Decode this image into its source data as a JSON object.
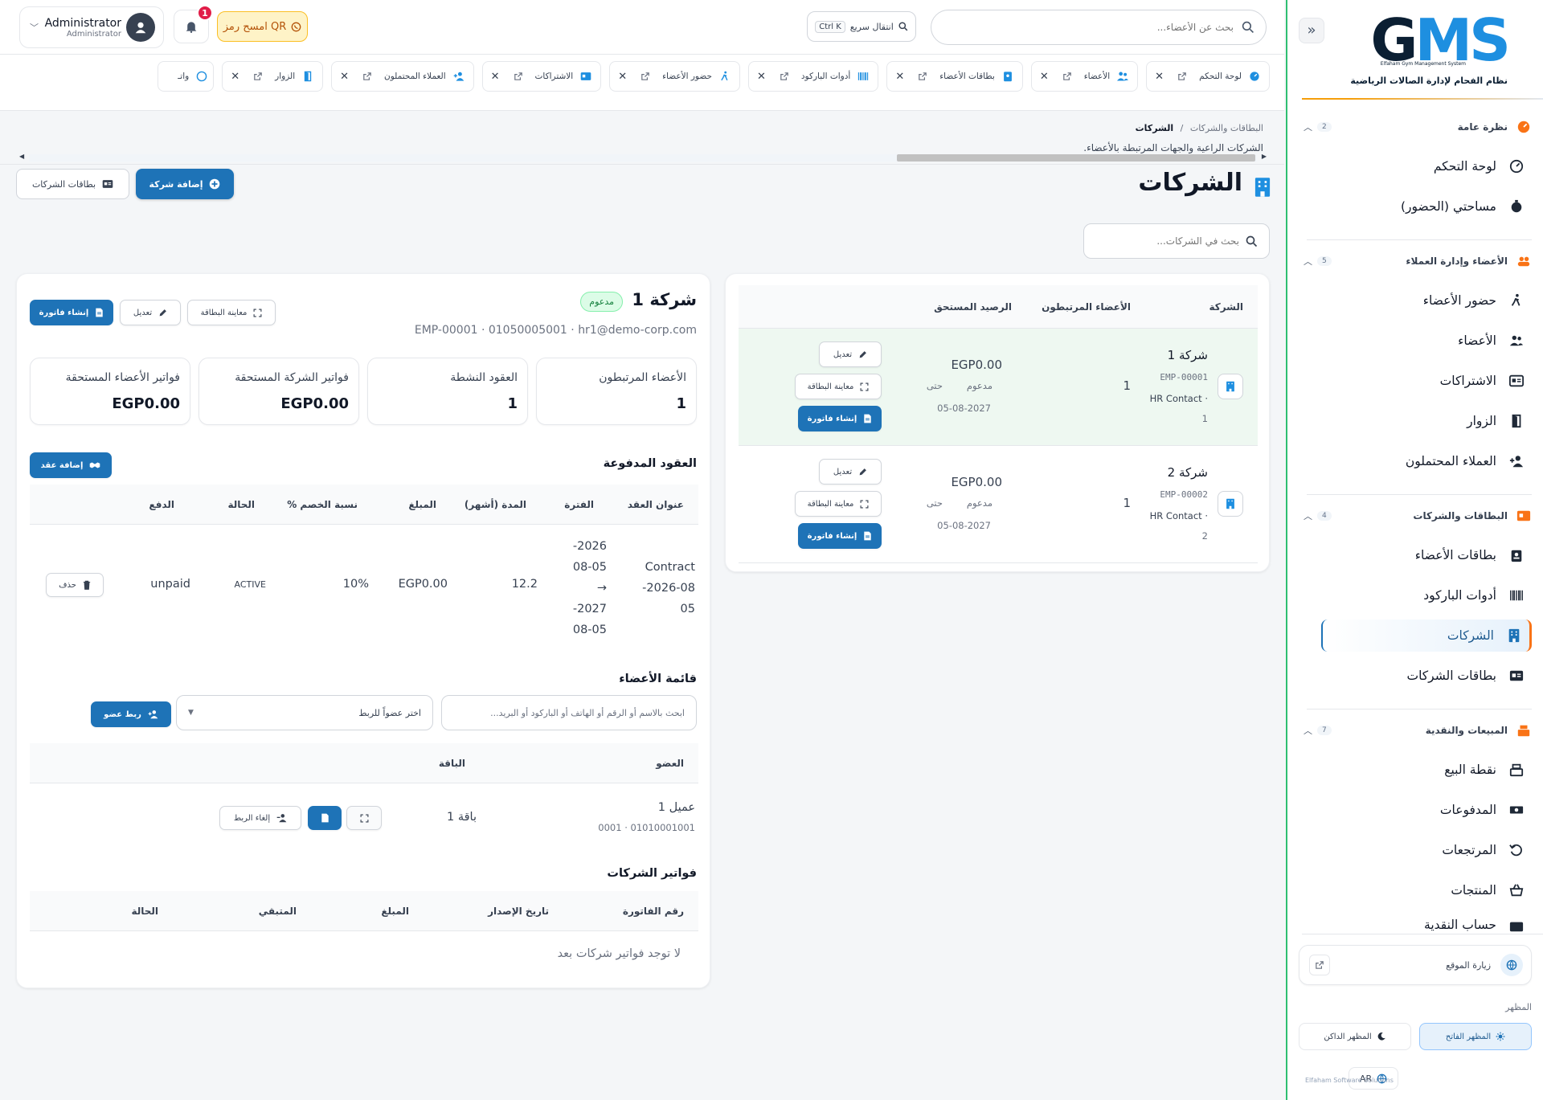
{
  "sidebar": {
    "logo_en": "Elfaham Gym Management System",
    "logo_ar": "نظام الفحام لإدارة الصالات الرياضية",
    "sections": [
      {
        "title": "نظرة عامة",
        "count": "2",
        "items": [
          "لوحة التحكم",
          "مساحتي (الحضور)"
        ]
      },
      {
        "title": "الأعضاء وإدارة العملاء",
        "count": "5",
        "items": [
          "حضور الأعضاء",
          "الأعضاء",
          "الاشتراكات",
          "الزوار",
          "العملاء المحتملون"
        ]
      },
      {
        "title": "البطاقات والشركات",
        "count": "4",
        "items": [
          "بطاقات الأعضاء",
          "أدوات الباركود",
          "الشركات",
          "بطاقات الشركات"
        ]
      },
      {
        "title": "المبيعات والنقدية",
        "count": "7",
        "items": [
          "نقطة البيع",
          "المدفوعات",
          "المرتجعات",
          "المنتجات",
          "حساب النقدية"
        ]
      }
    ],
    "visit_site": "زيارة الموقع",
    "appearance_label": "المظهر",
    "theme_light": "المظهر الفاتح",
    "theme_dark": "المظهر الداكن",
    "lang": "AR",
    "footer": "Elfaham Software Solutions"
  },
  "header": {
    "user_name": "Administrator",
    "user_role": "Administrator",
    "notif_count": "1",
    "qr_label": "امسح رمز QR",
    "quick_jump": "انتقال سريع",
    "quick_jump_kbd": "Ctrl K",
    "member_search_placeholder": "بحث عن الأعضاء..."
  },
  "tabs": [
    "لوحة التحكم",
    "الأعضاء",
    "بطاقات الأعضاء",
    "أدوات الباركود",
    "حضور الأعضاء",
    "الاشتراكات",
    "العملاء المحتملون",
    "الزوار",
    "واتـ"
  ],
  "page": {
    "breadcrumb_parent": "البطاقات والشركات",
    "breadcrumb_sep": "/",
    "breadcrumb_current": "الشركات",
    "subtitle": "الشركات الراعية والجهات المرتبطة بالأعضاء.",
    "title": "الشركات",
    "add_company": "إضافة شركة",
    "company_cards": "بطاقات الشركات",
    "search_placeholder": "بحث في الشركات..."
  },
  "company_list": {
    "columns": [
      "الشركة",
      "الأعضاء المرتبطون",
      "الرصيد المستحق"
    ],
    "rows": [
      {
        "name": "شركة 1",
        "code": "EMP-00001",
        "contact": "· HR Contact",
        "num": "1",
        "members": "1",
        "balance": "EGP0.00",
        "status": "مدعوم",
        "until": "حتى",
        "date": "05-08-2027"
      },
      {
        "name": "شركة 2",
        "code": "EMP-00002",
        "contact": "· HR Contact",
        "num": "2",
        "members": "1",
        "balance": "EGP0.00",
        "status": "مدعوم",
        "until": "حتى",
        "date": "05-08-2027"
      }
    ],
    "edit": "تعديل",
    "preview_card": "معاينة البطاقة",
    "create_invoice": "إنشاء فاتورة"
  },
  "detail": {
    "name": "شركة 1",
    "badge": "مدعوم",
    "info": "EMP-00001 · 01050005001 · hr1@demo-corp.com",
    "buttons": {
      "preview_card": "معاينة البطاقة",
      "edit": "تعديل",
      "create_invoice": "إنشاء فاتورة"
    },
    "stats": [
      {
        "label": "الأعضاء المرتبطون",
        "value": "1"
      },
      {
        "label": "العقود النشطة",
        "value": "1"
      },
      {
        "label": "فواتير الشركة المستحقة",
        "value": "EGP0.00"
      },
      {
        "label": "فواتير الأعضاء المستحقة",
        "value": "EGP0.00"
      }
    ],
    "contracts": {
      "title": "العقود المدفوعة",
      "add": "إضافة عقد",
      "columns": [
        "عنوان العقد",
        "الفترة",
        "المدة (أشهر)",
        "المبلغ",
        "نسبة الخصم %",
        "الحالة",
        "الدفع"
      ],
      "row": {
        "title_lines": [
          "Contract",
          "2026-08-",
          "05"
        ],
        "period_lines": [
          "2026-",
          "08-05",
          "→",
          "2027-",
          "08-05"
        ],
        "months": "12.2",
        "amount": "EGP0.00",
        "discount": "10%",
        "status": "ACTIVE",
        "payment": "unpaid",
        "delete": "حذف"
      }
    },
    "members": {
      "title": "قائمة الأعضاء",
      "search_placeholder": "ابحث بالاسم أو الرقم أو الهاتف أو الباركود أو البريد...",
      "select_placeholder": "اختر عضواً للربط",
      "link": "ربط عضو",
      "columns": [
        "العضو",
        "الباقة"
      ],
      "row": {
        "name": "عميل 1",
        "meta": "01010001001 · 0001",
        "package": "باقة 1",
        "unlink": "إلغاء الربط"
      }
    },
    "invoices": {
      "title": "فواتير الشركات",
      "columns": [
        "رقم الفاتورة",
        "تاريخ الإصدار",
        "المبلغ",
        "المتبقي",
        "الحالة"
      ],
      "empty": "لا توجد فواتير شركات بعد"
    }
  }
}
